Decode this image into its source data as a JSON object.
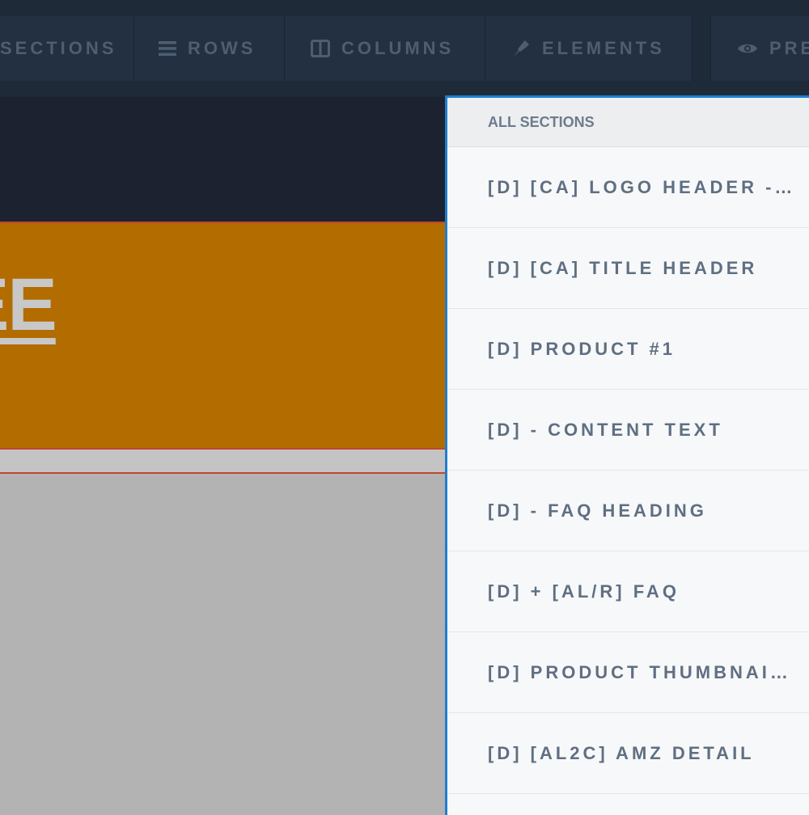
{
  "toolbar": {
    "sections_label": "SECTIONS",
    "rows_label": "ROWS",
    "columns_label": "COLUMNS",
    "elements_label": "ELEMENTS",
    "preview_label": "PREVIEW"
  },
  "canvas": {
    "headline_fragment": "EE"
  },
  "panel": {
    "header": "ALL SECTIONS",
    "items": [
      {
        "label": "[D] [CA] LOGO HEADER -…"
      },
      {
        "label": "[D] [CA] TITLE HEADER"
      },
      {
        "label": "[D] PRODUCT #1"
      },
      {
        "label": "[D] - CONTENT TEXT"
      },
      {
        "label": "[D] - FAQ HEADING"
      },
      {
        "label": "[D] + [AL/R] FAQ"
      },
      {
        "label": "[D] PRODUCT THUMBNAI…"
      },
      {
        "label": "[D] [AL2C] AMZ DETAIL"
      }
    ]
  },
  "colors": {
    "toolbar_bg": "#1f2a38",
    "accent_blue": "#1f7ecf",
    "orange": "#b26c00"
  },
  "icons": [
    "rows-icon",
    "columns-icon",
    "elements-icon",
    "preview-eye-icon"
  ]
}
